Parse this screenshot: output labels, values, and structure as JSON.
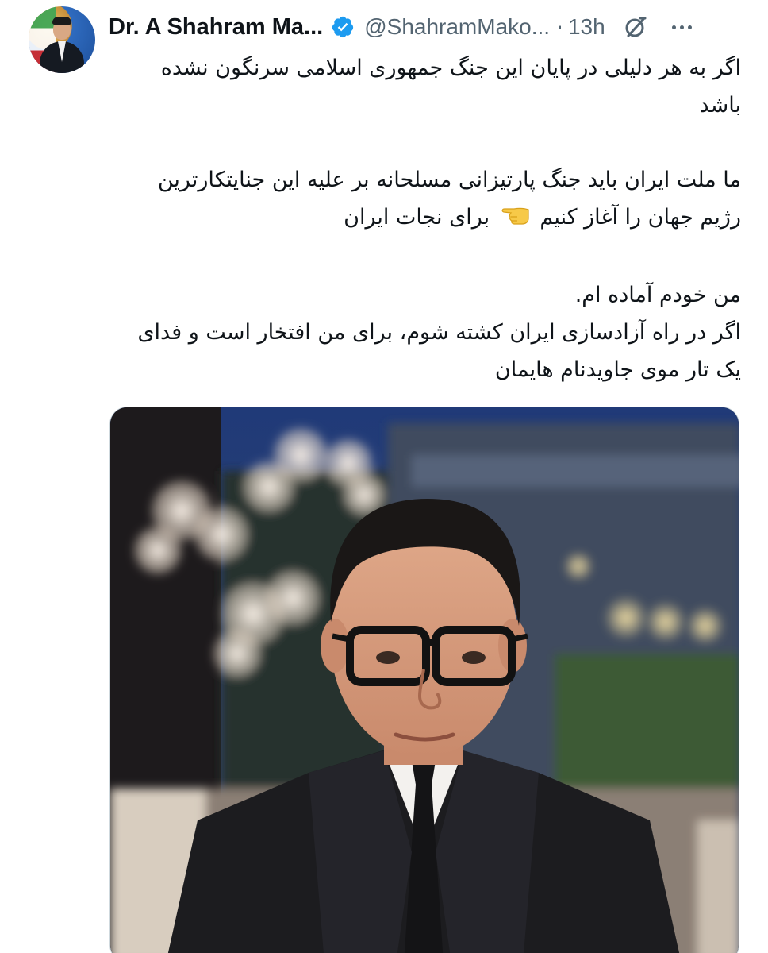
{
  "author": {
    "display_name": "Dr. A Shahram Ma...",
    "handle": "@ShahramMako...",
    "separator": "·",
    "timestamp": "13h",
    "verified": true
  },
  "tweet": {
    "line1": "اگر به هر دلیلی در پایان این جنگ جمهوری اسلامی سرنگون نشده",
    "line2": "باشد",
    "line3": "ما ملت ایران باید جنگ پارتیزانی مسلحانه بر علیه این جنایتکارترین",
    "line4_part1": "رژیم جهان را آغاز کنیم",
    "line4_part2": "برای نجات ایران",
    "line5": "من خودم آماده ام.",
    "line6": "اگر در راه آزادسازی ایران کشته شوم، برای من افتخار است و فدای",
    "line7": "یک تار موی جاویدنام هایمان"
  },
  "icons": {
    "verified": "verified-badge-icon",
    "grok": "grok-icon",
    "more": "more-options-icon",
    "emoji": "backhand-index-pointing-left-emoji"
  },
  "colors": {
    "text_primary": "#0f1419",
    "text_secondary": "#536471",
    "verified_blue": "#1d9bf0",
    "border": "#cfd9de"
  }
}
